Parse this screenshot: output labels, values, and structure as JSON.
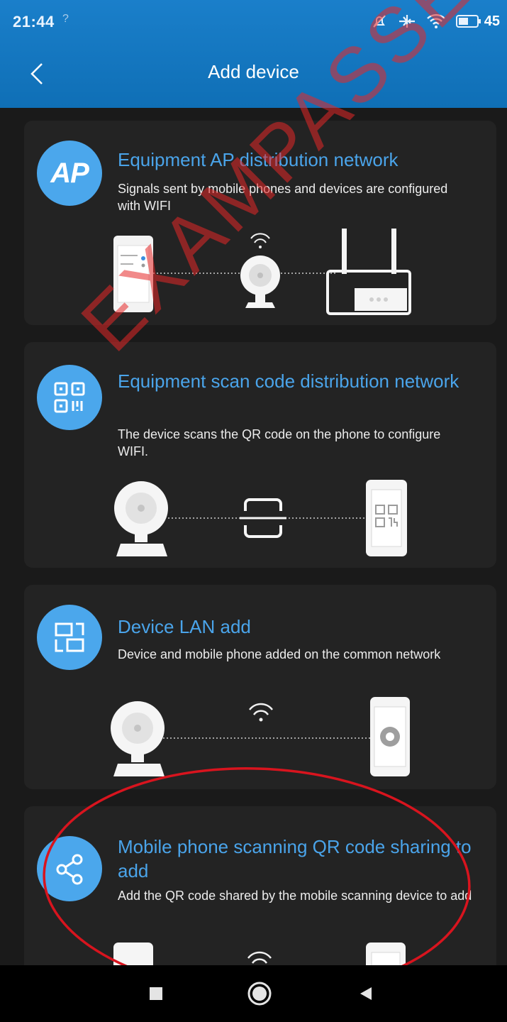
{
  "status_bar": {
    "time": "21:44",
    "sub_indicator": "?",
    "battery_level": "45",
    "icons": [
      "mute-icon",
      "airplane-icon",
      "wifi-icon",
      "battery-icon"
    ]
  },
  "header": {
    "title": "Add device",
    "back_icon": "chevron-left-icon",
    "color": "#1a7fca"
  },
  "cards": [
    {
      "icon_text": "AP",
      "title": "Equipment AP distribution network",
      "description": "Signals sent by mobile phones and devices are configured with WIFI"
    },
    {
      "icon": "qr-code-icon",
      "title": "Equipment scan code distribution network",
      "description": "The device scans the QR code on the phone to configure WIFI."
    },
    {
      "icon": "lan-icon",
      "title": "Device LAN add",
      "description": "Device and mobile phone added on the common network"
    },
    {
      "icon": "share-icon",
      "title": "Mobile phone scanning QR code sharing to add",
      "description": "Add the QR code shared by the mobile scanning device to add"
    }
  ],
  "watermark": "EXAMPASSED.NET",
  "nav_bar": {
    "icons": [
      "recents-square-icon",
      "home-circle-icon",
      "back-triangle-icon"
    ]
  },
  "accent_color": "#4aa4ea",
  "annotation_color": "#d8141e"
}
